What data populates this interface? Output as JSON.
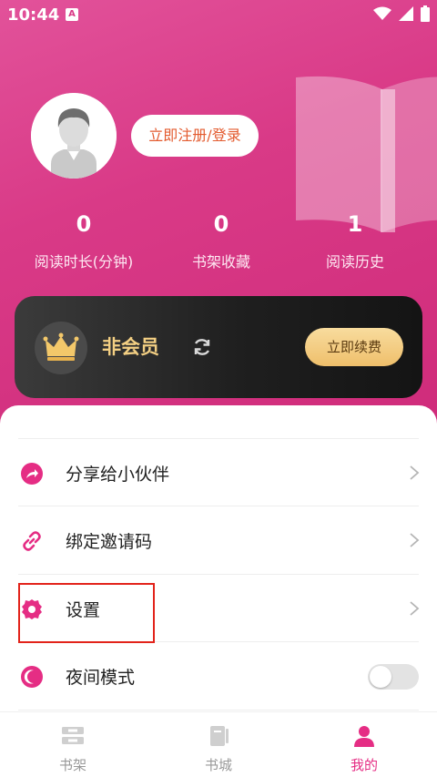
{
  "status_bar": {
    "time": "10:44",
    "notification_badge": "A"
  },
  "profile": {
    "login_label": "立即注册/登录"
  },
  "stats": [
    {
      "value": "0",
      "label": "阅读时长(分钟)"
    },
    {
      "value": "0",
      "label": "书架收藏"
    },
    {
      "value": "1",
      "label": "阅读历史"
    }
  ],
  "vip": {
    "title": "非会员",
    "renew_label": "立即续费"
  },
  "menu": [
    {
      "label": "分享给小伙伴",
      "icon": "share-icon"
    },
    {
      "label": "绑定邀请码",
      "icon": "link-icon"
    },
    {
      "label": "设置",
      "icon": "gear-icon"
    },
    {
      "label": "夜间模式",
      "icon": "moon-icon"
    }
  ],
  "tabs": [
    {
      "label": "书架",
      "icon": "bookshelf-icon"
    },
    {
      "label": "书城",
      "icon": "bookstore-icon"
    },
    {
      "label": "我的",
      "icon": "profile-icon",
      "active": true
    }
  ],
  "colors": {
    "accent": "#e52d84",
    "gold": "#f3cf83",
    "highlight": "#e2231a"
  }
}
